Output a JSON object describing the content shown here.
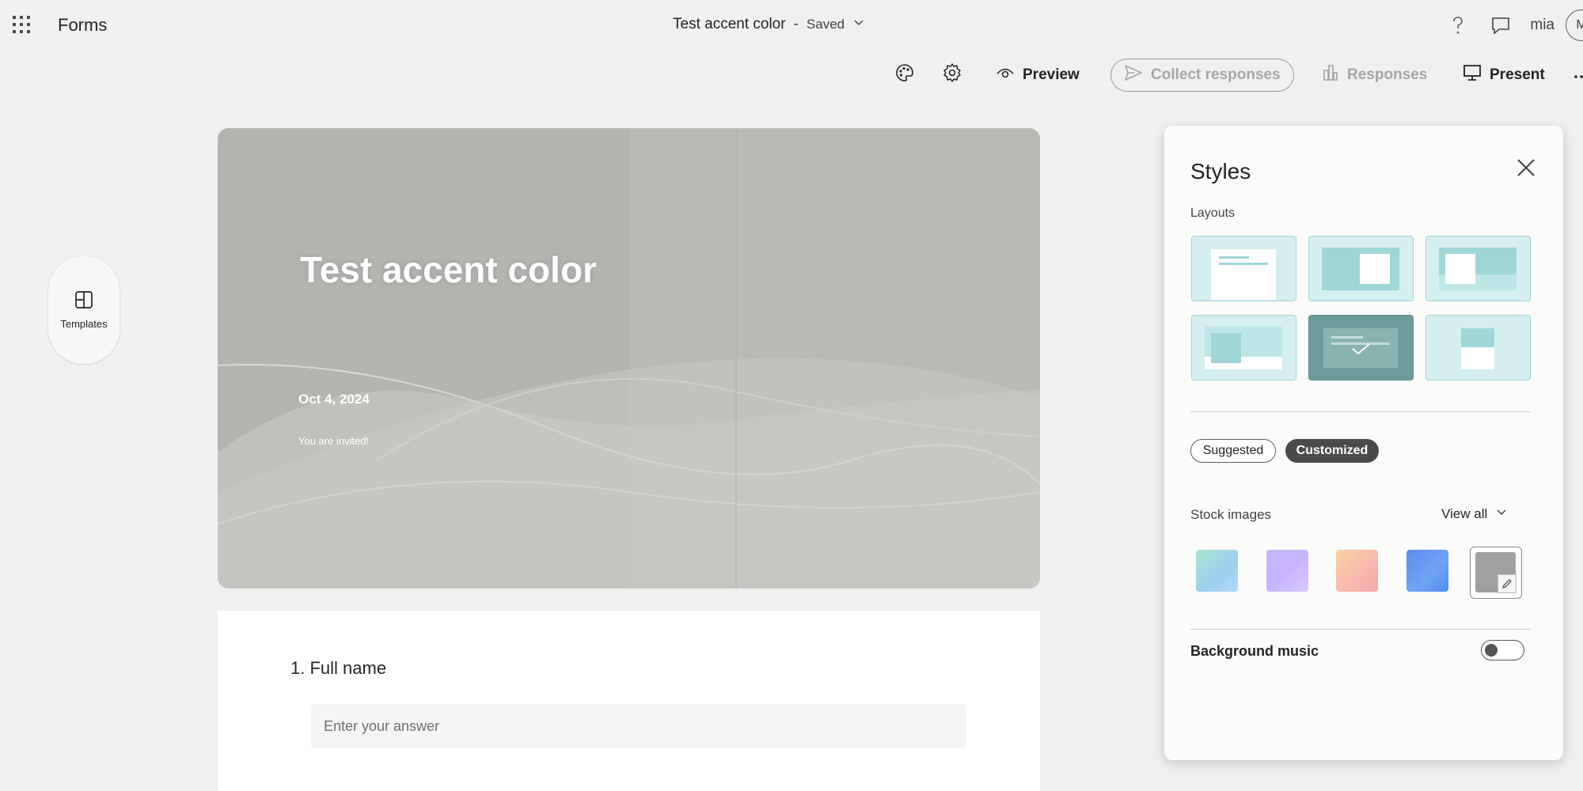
{
  "app": {
    "name": "Forms"
  },
  "document": {
    "title": "Test accent color",
    "separator": "-",
    "status": "Saved"
  },
  "user": {
    "name": "mia",
    "avatar_initial": "M"
  },
  "toolbar": {
    "preview_label": "Preview",
    "collect_label": "Collect responses",
    "responses_label": "Responses",
    "present_label": "Present"
  },
  "sidebar": {
    "templates_label": "Templates"
  },
  "hero": {
    "title": "Test accent color",
    "date": "Oct 4, 2024",
    "subtitle": "You are invited!"
  },
  "question": {
    "number_label": "1. Full name",
    "placeholder": "Enter your answer"
  },
  "styles_panel": {
    "title": "Styles",
    "layouts_label": "Layouts",
    "selected_layout_index": 4,
    "chips": {
      "suggested": "Suggested",
      "customized": "Customized",
      "active": "customized"
    },
    "stock_images_label": "Stock images",
    "view_all_label": "View all",
    "background_music_label": "Background music",
    "background_music_on": false
  },
  "colors": {
    "accent_teal": "#9fd6d8",
    "selected_layout": "#6e9b9b",
    "chip_active": "#4a4a4a",
    "hero_grey": "#b8b8b5"
  }
}
